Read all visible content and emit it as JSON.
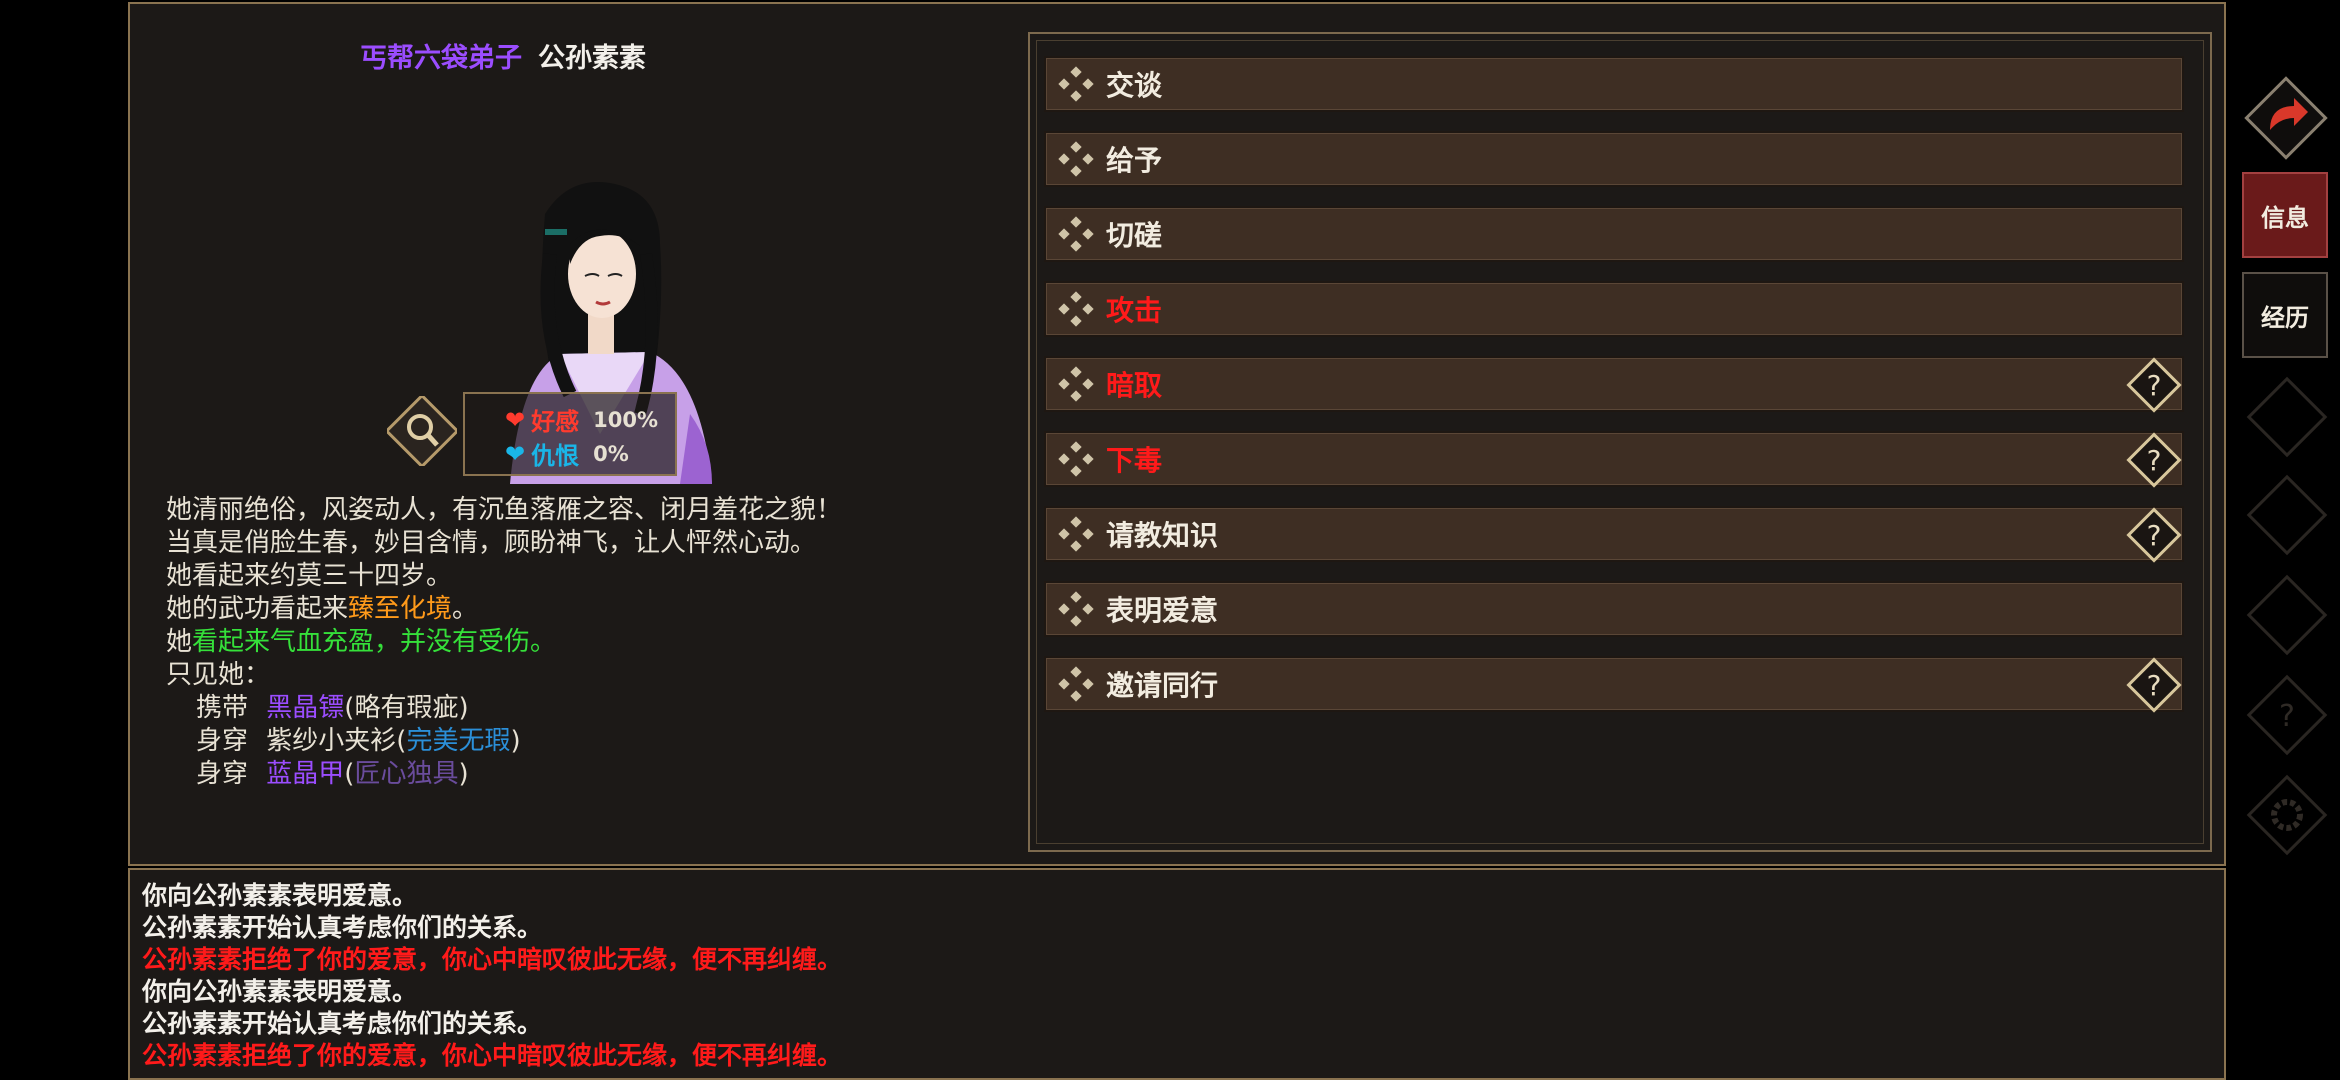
{
  "npc": {
    "rank": "丐帮六袋弟子",
    "name": "公孙素素",
    "favor_label": "好感",
    "favor_value": "100%",
    "hate_label": "仇恨",
    "hate_value": "0%"
  },
  "description": {
    "line1": "她清丽绝俗，风姿动人，有沉鱼落雁之容、闭月羞花之貌！",
    "line2": "当真是俏脸生春，妙目含情，顾盼神飞，让人怦然心动。",
    "line3": "她看起来约莫三十四岁。",
    "line4_prefix": "她的武功看起来",
    "line4_level": "臻至化境",
    "line4_suffix": "。",
    "line5_prefix": "她",
    "line5_status": "看起来气血充盈，并没有受伤。",
    "line6": "只见她：",
    "equip": [
      {
        "verb": "携带",
        "item": "黑晶镖",
        "paren_open": "(",
        "quality": "略有瑕疵",
        "paren_close": ")"
      },
      {
        "verb": "身穿",
        "item": "紫纱小夹衫",
        "paren_open": "(",
        "quality": "完美无瑕",
        "paren_close": ")"
      },
      {
        "verb": "身穿",
        "item": "蓝晶甲",
        "paren_open": "(",
        "quality": "匠心独具",
        "paren_close": ")"
      }
    ]
  },
  "actions": [
    {
      "label": "交谈",
      "color": "normal",
      "help": false
    },
    {
      "label": "给予",
      "color": "normal",
      "help": false
    },
    {
      "label": "切磋",
      "color": "normal",
      "help": false
    },
    {
      "label": "攻击",
      "color": "red",
      "help": false
    },
    {
      "label": "暗取",
      "color": "red",
      "help": true
    },
    {
      "label": "下毒",
      "color": "red",
      "help": true
    },
    {
      "label": "请教知识",
      "color": "normal",
      "help": true
    },
    {
      "label": "表明爱意",
      "color": "normal",
      "help": false
    },
    {
      "label": "邀请同行",
      "color": "normal",
      "help": true
    }
  ],
  "log": [
    {
      "text": "你向公孙素素表明爱意。",
      "color": "white"
    },
    {
      "text": "公孙素素开始认真考虑你们的关系。",
      "color": "white"
    },
    {
      "text": "公孙素素拒绝了你的爱意，你心中暗叹彼此无缘，便不再纠缠。",
      "color": "red"
    },
    {
      "text": "你向公孙素素表明爱意。",
      "color": "white"
    },
    {
      "text": "公孙素素开始认真考虑你们的关系。",
      "color": "white"
    },
    {
      "text": "公孙素素拒绝了你的爱意，你心中暗叹彼此无缘，便不再纠缠。",
      "color": "red"
    }
  ],
  "side_nav": {
    "back_icon": "back-arrow-icon",
    "tab_info": "信息",
    "tab_history": "经历"
  },
  "colors": {
    "accent_gold": "#8a7350",
    "rank_purple": "#9b4dff",
    "danger_red": "#ff1a1a",
    "favor_red": "#ff3b2e",
    "hate_cyan": "#1ab6e8"
  }
}
